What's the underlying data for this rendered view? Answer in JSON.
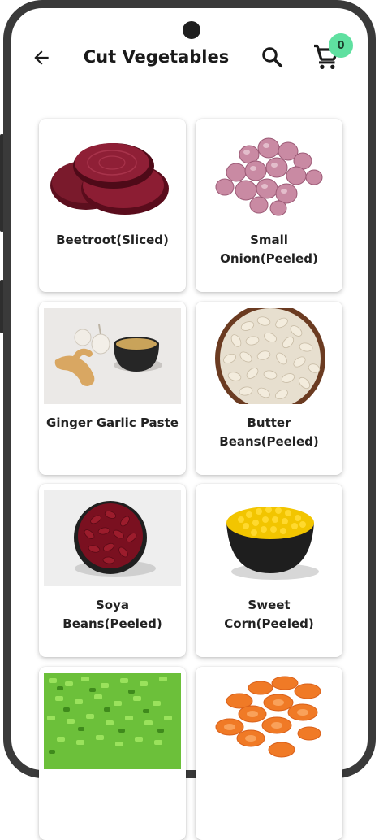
{
  "header": {
    "title": "Cut Vegetables",
    "cart_count": "0",
    "badge_color": "#5fe0a0"
  },
  "products": [
    {
      "name": "Beetroot(Sliced)",
      "icon": "beetroot-image"
    },
    {
      "name": "Small Onion(Peeled)",
      "icon": "small-onion-image"
    },
    {
      "name": "Ginger Garlic Paste",
      "icon": "ginger-garlic-image"
    },
    {
      "name": "Butter Beans(Peeled)",
      "icon": "butter-beans-image"
    },
    {
      "name": "Soya Beans(Peeled)",
      "icon": "soya-beans-image"
    },
    {
      "name": "Sweet Corn(Peeled)",
      "icon": "sweet-corn-image"
    },
    {
      "name": "",
      "icon": "chopped-green-beans-image"
    },
    {
      "name": "",
      "icon": "sliced-carrot-image"
    }
  ]
}
